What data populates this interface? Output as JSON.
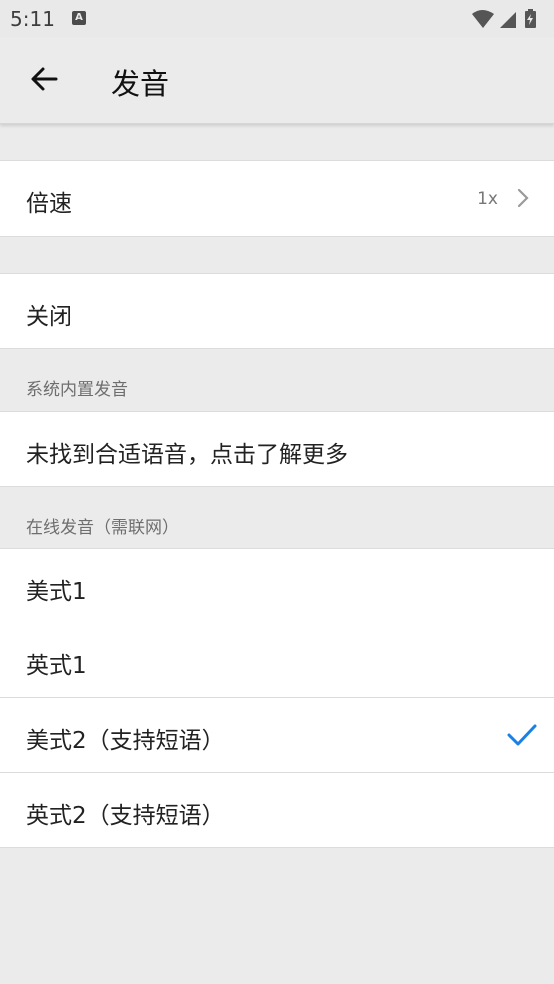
{
  "status_bar": {
    "time": "5:11",
    "notification_icon": "a-icon",
    "icons": [
      "wifi-icon",
      "signal-icon",
      "battery-charging-icon"
    ]
  },
  "appbar": {
    "title": "发音",
    "back_icon": "arrow-left-icon"
  },
  "speed": {
    "label": "倍速",
    "value": "1x"
  },
  "off": {
    "label": "关闭"
  },
  "system_section": {
    "header": "系统内置发音",
    "hint": "未找到合适语音，点击了解更多"
  },
  "online_section": {
    "header": "在线发音（需联网）",
    "options": [
      {
        "label": "美式1",
        "selected": false
      },
      {
        "label": "英式1",
        "selected": false
      },
      {
        "label": "美式2（支持短语）",
        "selected": true
      },
      {
        "label": "英式2（支持短语）",
        "selected": false
      }
    ]
  },
  "colors": {
    "accent": "#1a7fe6",
    "background": "#ebebeb",
    "row": "#ffffff"
  }
}
